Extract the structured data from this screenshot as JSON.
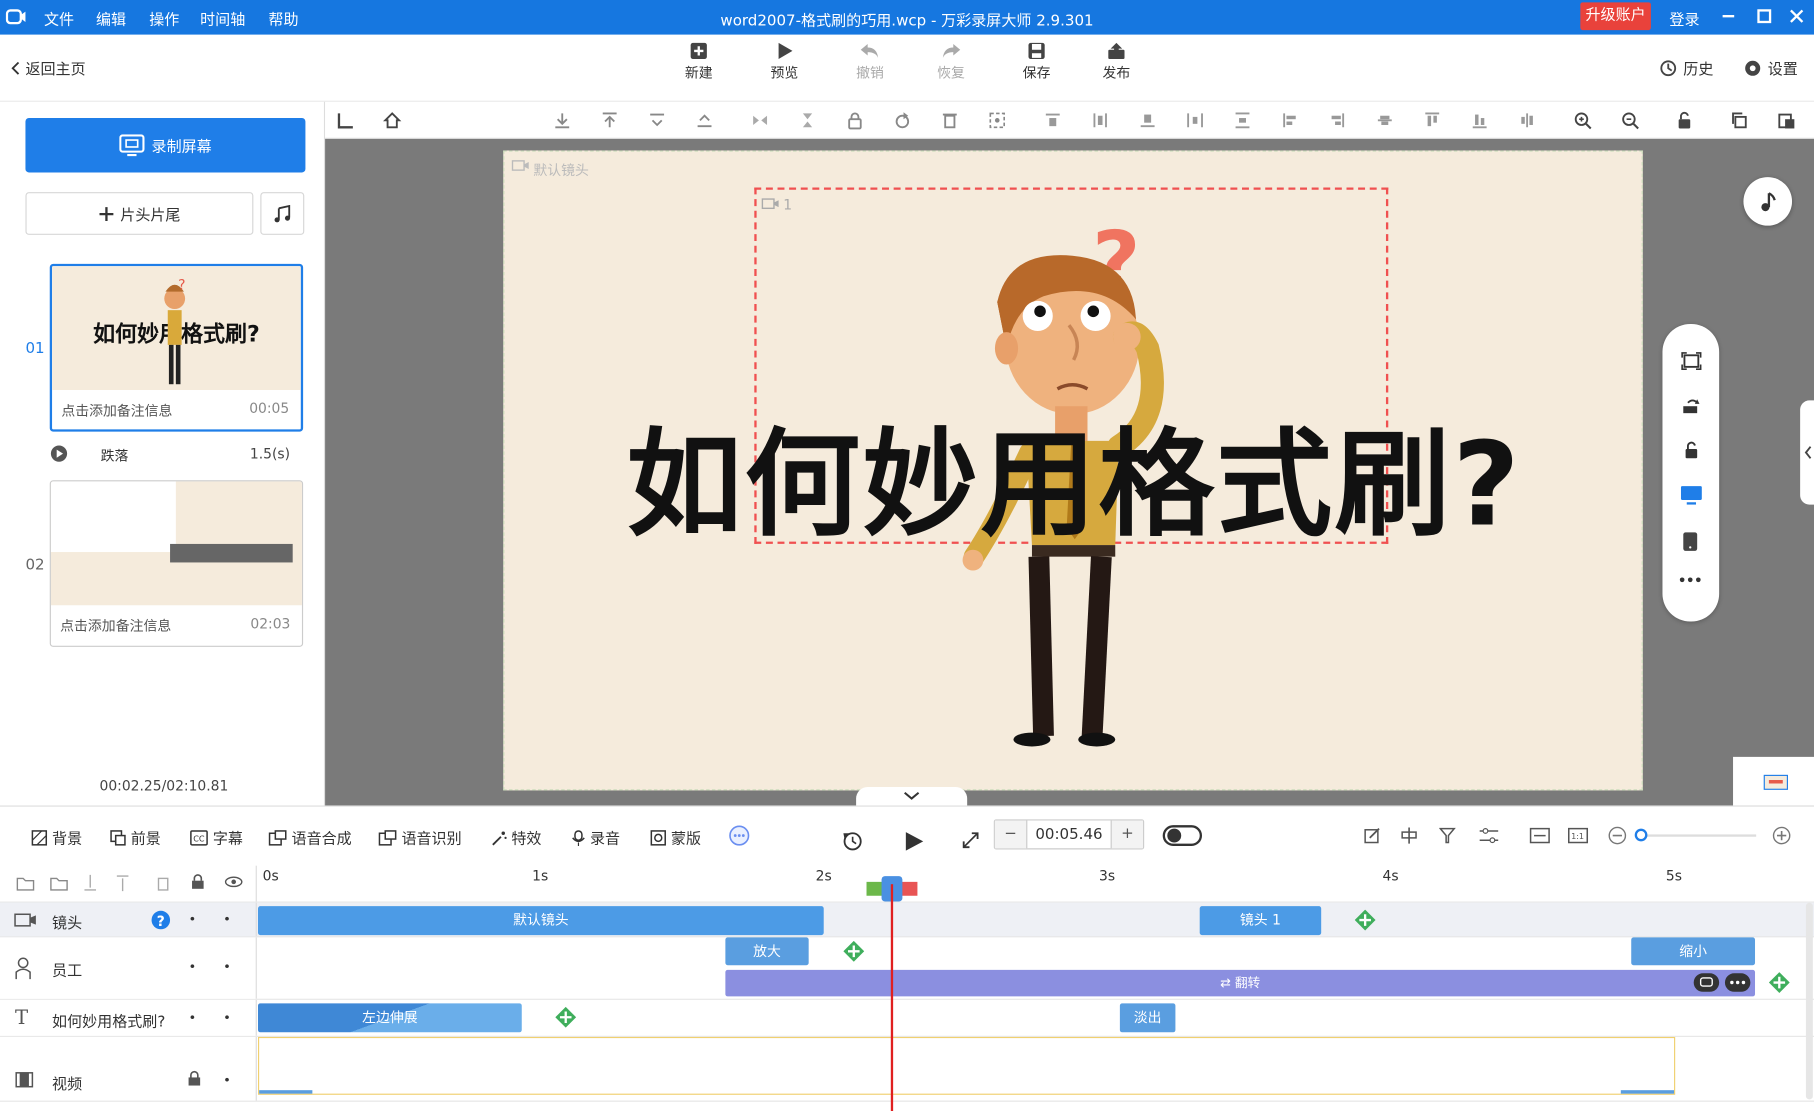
{
  "app": {
    "title": "word2007-格式刷的巧用.wcp - 万彩录屏大师 2.9.301",
    "menu": [
      "文件",
      "编辑",
      "操作",
      "时间轴",
      "帮助"
    ],
    "upgrade": "升级账户",
    "login": "登录",
    "brand_color": "#1677e0"
  },
  "toolbar": {
    "back": "返回主页",
    "new": "新建",
    "preview": "预览",
    "undo": "撤销",
    "redo": "恢复",
    "save": "保存",
    "publish": "发布",
    "history": "历史",
    "settings": "设置"
  },
  "left": {
    "record": "录制屏幕",
    "head_tail": "片头片尾",
    "scenes": [
      {
        "num": "01",
        "title": "如何妙用格式刷?",
        "note": "点击添加备注信息",
        "duration": "00:05"
      },
      {
        "num": "02",
        "note": "点击添加备注信息",
        "duration": "02:03"
      }
    ],
    "transition": {
      "name": "跌落",
      "duration": "1.5(s)"
    },
    "time_readout": "00:02.25/02:10.81"
  },
  "canvas": {
    "default_cam": "默认镜头",
    "cam1": "1",
    "title": "如何妙用格式刷?"
  },
  "timeline_tools": {
    "items": [
      "背景",
      "前景",
      "字幕",
      "语音合成",
      "语音识别",
      "特效",
      "录音",
      "蒙版"
    ],
    "time": "00:05.46"
  },
  "timeline": {
    "ticks": [
      "0s",
      "1s",
      "2s",
      "3s",
      "4s",
      "5s"
    ],
    "tracks": [
      {
        "name": "镜头",
        "clips": [
          "默认镜头",
          "镜头 1"
        ]
      },
      {
        "name": "员工",
        "clips": [
          "放大",
          "缩小",
          "翻转"
        ]
      },
      {
        "name": "如何妙用格式刷?",
        "clips": [
          "左边伸展",
          "淡出"
        ]
      },
      {
        "name": "视频"
      }
    ]
  }
}
